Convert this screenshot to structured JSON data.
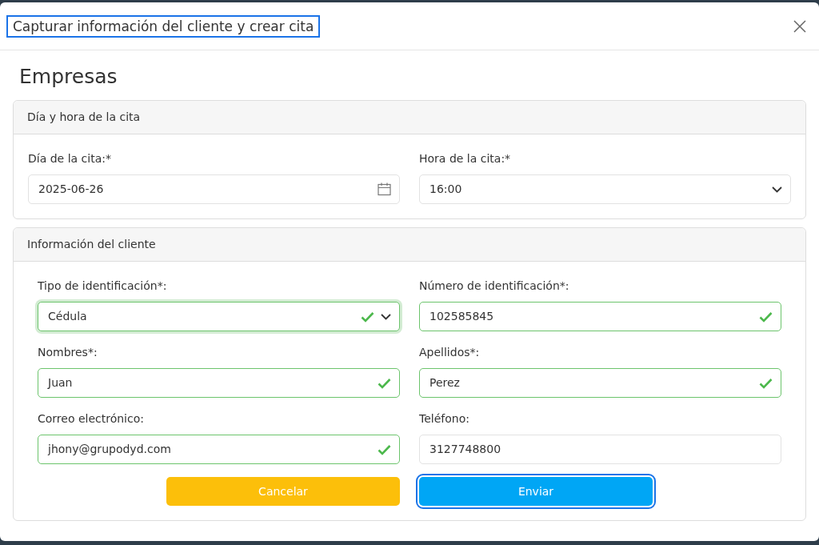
{
  "modal": {
    "title": "Capturar información del cliente y crear cita",
    "title_focused": true
  },
  "heading": "Empresas",
  "sections": [
    {
      "title": "Día y hora de la cita",
      "fields": [
        {
          "kind": "date",
          "label": "Día de la cita:*",
          "value": "2025-06-26",
          "valid": false,
          "focused": false
        },
        {
          "kind": "select",
          "label": "Hora de la cita:*",
          "value": "16:00",
          "valid": false,
          "focused": false
        }
      ]
    },
    {
      "title": "Información del cliente",
      "fields": [
        {
          "kind": "select",
          "label": "Tipo de identificación*:",
          "value": "Cédula",
          "valid": true,
          "focused": true
        },
        {
          "kind": "text",
          "label": "Número de identificación*:",
          "value": "102585845",
          "valid": true,
          "focused": false
        },
        {
          "kind": "text",
          "label": "Nombres*:",
          "value": "Juan",
          "valid": true,
          "focused": false
        },
        {
          "kind": "text",
          "label": "Apellidos*:",
          "value": "Perez",
          "valid": true,
          "focused": false
        },
        {
          "kind": "text",
          "label": "Correo electrónico:",
          "value": "jhony@grupodyd.com",
          "valid": true,
          "focused": false
        },
        {
          "kind": "text",
          "label": "Teléfono:",
          "value": "3127748800",
          "valid": false,
          "focused": false
        }
      ]
    }
  ],
  "buttons": [
    {
      "kind": "cancel",
      "label": "Cancelar",
      "focused": false
    },
    {
      "kind": "submit",
      "label": "Enviar",
      "focused": true
    }
  ]
}
